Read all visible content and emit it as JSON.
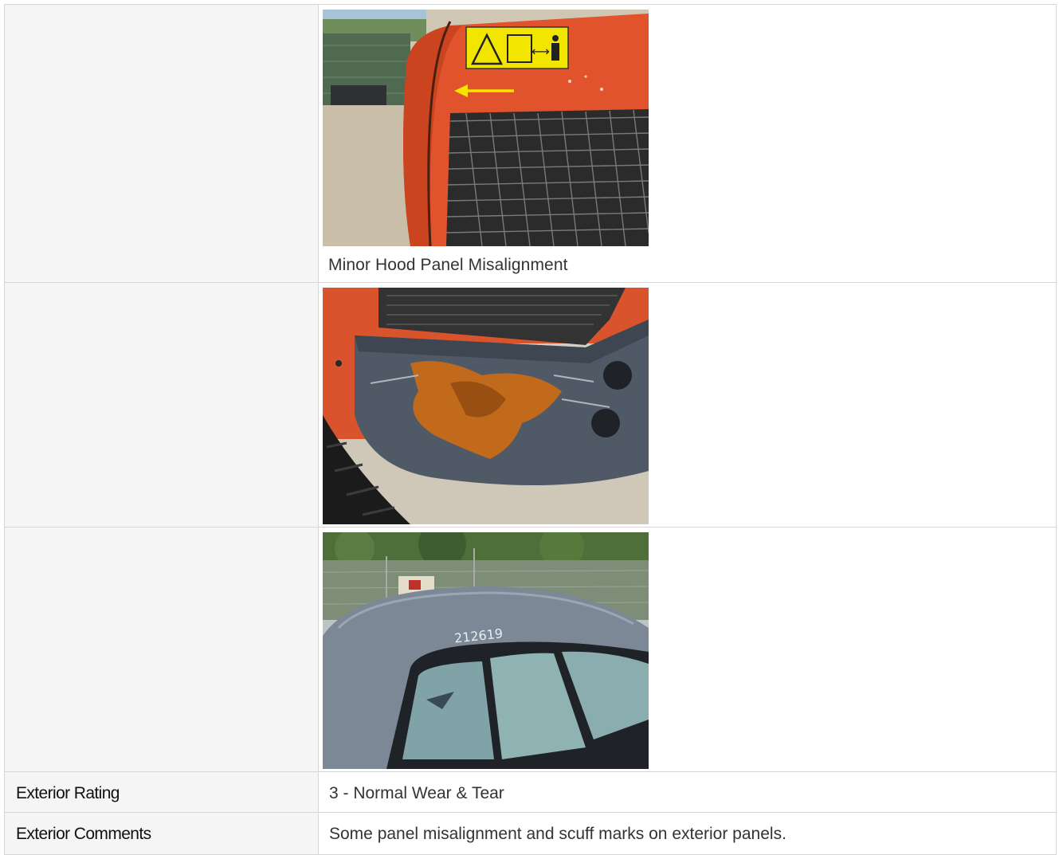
{
  "photos": [
    {
      "caption": "Minor Hood Panel Misalignment",
      "decal_symbol": "⟷"
    },
    {
      "caption": ""
    },
    {
      "caption": "",
      "cab_number": "212619"
    }
  ],
  "fields": [
    {
      "label": "Exterior Rating",
      "value": "3 - Normal Wear & Tear"
    },
    {
      "label": "Exterior Comments",
      "value": "Some panel misalignment and scuff marks on exterior panels."
    }
  ],
  "colors": {
    "label_bg": "#f5f5f5",
    "border": "#d6d6d6",
    "machine_orange": "#e0532c",
    "rust": "#c26a1c",
    "decal_yellow": "#f2e500"
  }
}
